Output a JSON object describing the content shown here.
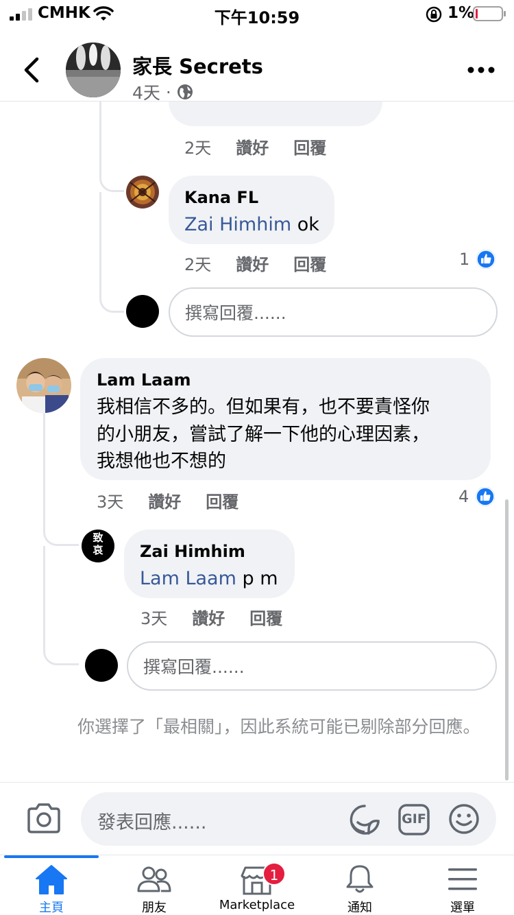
{
  "status_bar": {
    "carrier": "CMHK",
    "time": "下午10:59",
    "battery": "1%"
  },
  "header": {
    "page_name": "家長 Secrets",
    "post_age": "4天",
    "separator": "·",
    "privacy_icon": "globe-icon"
  },
  "comments": {
    "partial": {
      "time": "2天",
      "like": "讚好",
      "reply": "回覆"
    },
    "kana": {
      "author": "Kana FL",
      "mention": "Zai Himhim",
      "text": " ok",
      "time": "2天",
      "like": "讚好",
      "reply": "回覆",
      "likes": "1"
    },
    "reply_box_1": {
      "placeholder": "撰寫回覆......"
    },
    "lam": {
      "author": "Lam Laam",
      "line1": "我相信不多的。但如果有，也不要責怪你",
      "line2": "的小朋友，嘗試了解一下他的心理因素，",
      "line3": "我想他也不想的",
      "time": "3天",
      "like": "讚好",
      "reply": "回覆",
      "likes": "4"
    },
    "zai": {
      "author": "Zai Himhim",
      "avatar_text": "致哀",
      "mention": "Lam Laam",
      "text": " p m",
      "time": "3天",
      "like": "讚好",
      "reply": "回覆"
    },
    "reply_box_2": {
      "placeholder": "撰寫回覆......"
    }
  },
  "notice": "你選擇了「最相關」，因此系統可能已剔除部分回應。",
  "composer": {
    "placeholder": "發表回應......",
    "gif_label": "GIF"
  },
  "tabs": [
    {
      "label": "主頁",
      "icon": "home-icon",
      "active": true
    },
    {
      "label": "朋友",
      "icon": "friends-icon"
    },
    {
      "label": "Marketplace",
      "icon": "marketplace-icon",
      "badge": "1"
    },
    {
      "label": "通知",
      "icon": "bell-icon"
    },
    {
      "label": "選單",
      "icon": "menu-icon"
    }
  ],
  "colors": {
    "accent": "#1877f2",
    "mention": "#385898",
    "bubble": "#f0f2f5",
    "badge": "#e41e3f"
  }
}
